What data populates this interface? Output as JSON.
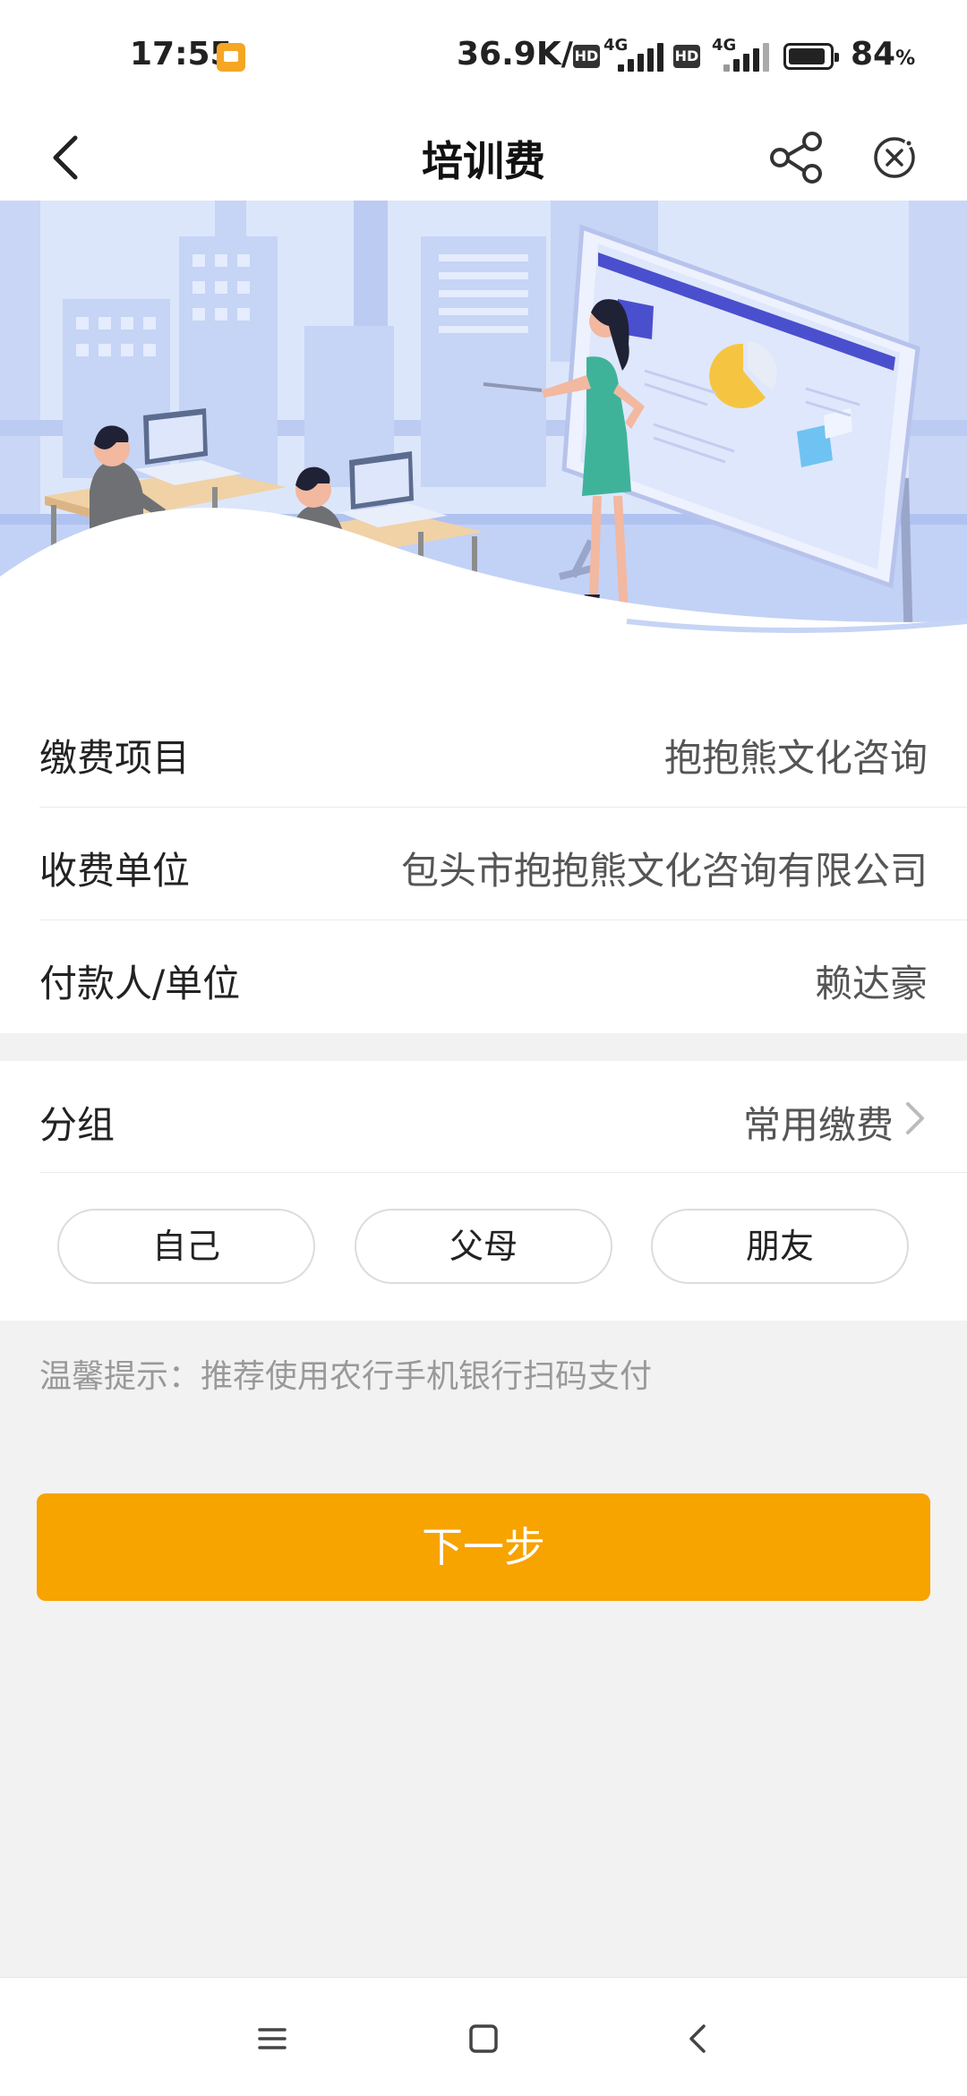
{
  "status_bar": {
    "time": "17:55",
    "net_speed": "36.9K/s",
    "sim1_hd": "HD",
    "sim1_network": "4G",
    "sim2_hd": "HD",
    "sim2_network": "4G",
    "battery_percent": "84",
    "battery_unit": "%"
  },
  "header": {
    "title": "培训费",
    "back_icon": "back-arrow-icon",
    "share_icon": "share-icon",
    "close_icon": "close-circle-icon"
  },
  "info": [
    {
      "label": "缴费项目",
      "value": "抱抱熊文化咨询"
    },
    {
      "label": "收费单位",
      "value": "包头市抱抱熊文化咨询有限公司"
    },
    {
      "label": "付款人/单位",
      "value": "赖达豪"
    }
  ],
  "group": {
    "label": "分组",
    "value": "常用缴费",
    "options": [
      "自己",
      "父母",
      "朋友"
    ]
  },
  "tip": "温馨提示：推荐使用农行手机银行扫码支付",
  "next_button": "下一步",
  "colors": {
    "accent": "#f7a300",
    "banner_bg": "#dce6fb",
    "banner_blue": "#4a5fd8"
  }
}
